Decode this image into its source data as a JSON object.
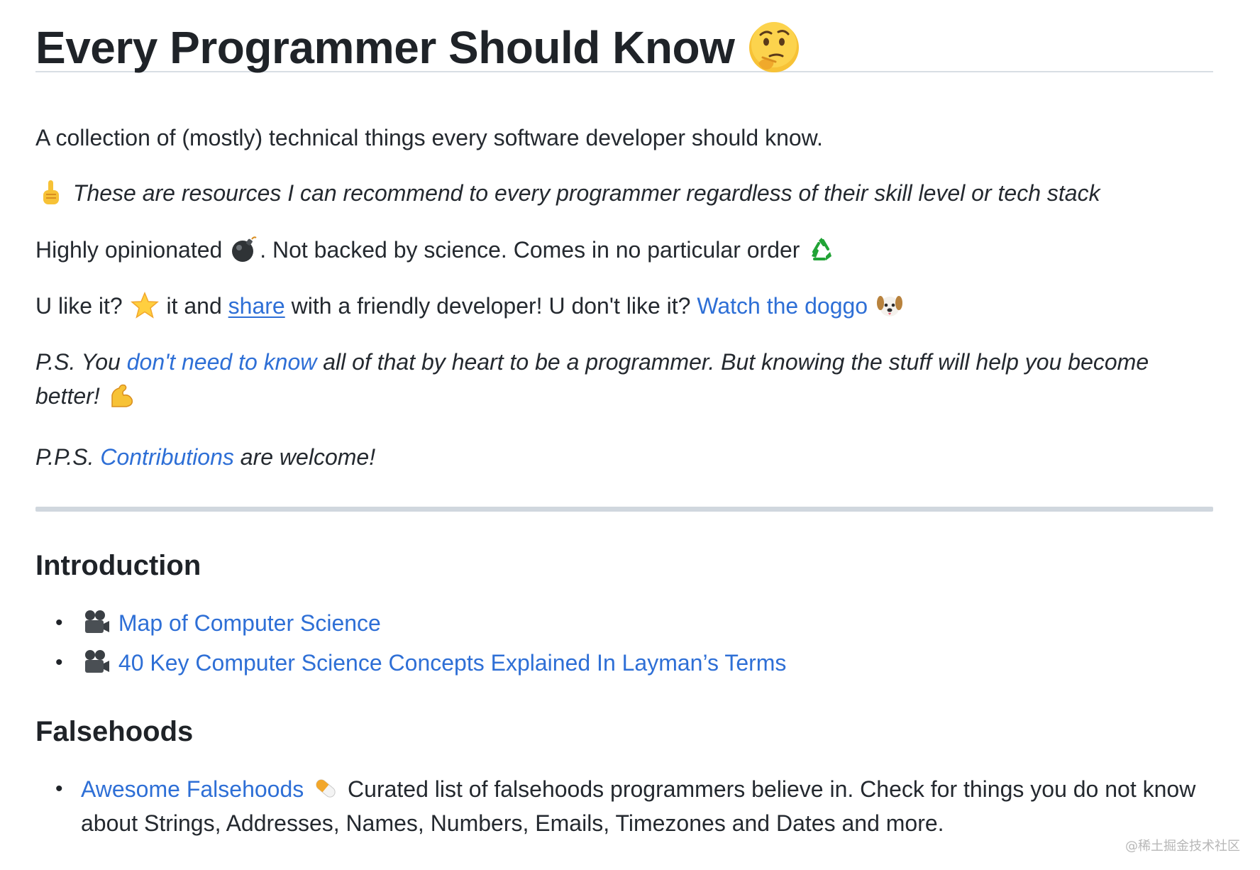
{
  "title": "Every Programmer Should Know",
  "intro": {
    "line1": "A collection of (mostly) technical things every software developer should know.",
    "line2": "These are resources I can recommend to every programmer regardless of their skill level or tech stack",
    "line3_a": "Highly opinionated ",
    "line3_b": ". Not backed by science. Comes in no particular order ",
    "line4_a": "U like it? ",
    "line4_b": " it and ",
    "line4_share": "share",
    "line4_c": " with a friendly developer! U don't like it? ",
    "line4_doggo": "Watch the doggo",
    "ps_a": "P.S. You ",
    "ps_link": "don't need to know",
    "ps_b": " all of that by heart to be a programmer. But knowing the stuff will help you become better! ",
    "pps_a": "P.P.S. ",
    "pps_link": "Contributions",
    "pps_b": " are welcome!"
  },
  "sections": {
    "introduction": {
      "heading": "Introduction",
      "items": [
        "Map of Computer Science",
        "40 Key Computer Science Concepts Explained In Layman’s Terms"
      ]
    },
    "falsehoods": {
      "heading": "Falsehoods",
      "item_link": "Awesome Falsehoods",
      "item_text": " Curated list of falsehoods programmers believe in. Check for things you do not know about Strings, Addresses, Names, Numbers, Emails, Timezones and Dates and more."
    }
  },
  "bullet": "•",
  "watermark": "@稀土掘金技术社区",
  "icons": [
    "thinking-face-icon",
    "pointing-up-icon",
    "bomb-icon",
    "recycle-icon",
    "star-icon",
    "dog-face-icon",
    "flexed-biceps-icon",
    "movie-camera-icon",
    "pill-icon"
  ],
  "colors": {
    "link": "#2e6fd6",
    "text": "#24292f",
    "rule": "#d0d7de"
  }
}
